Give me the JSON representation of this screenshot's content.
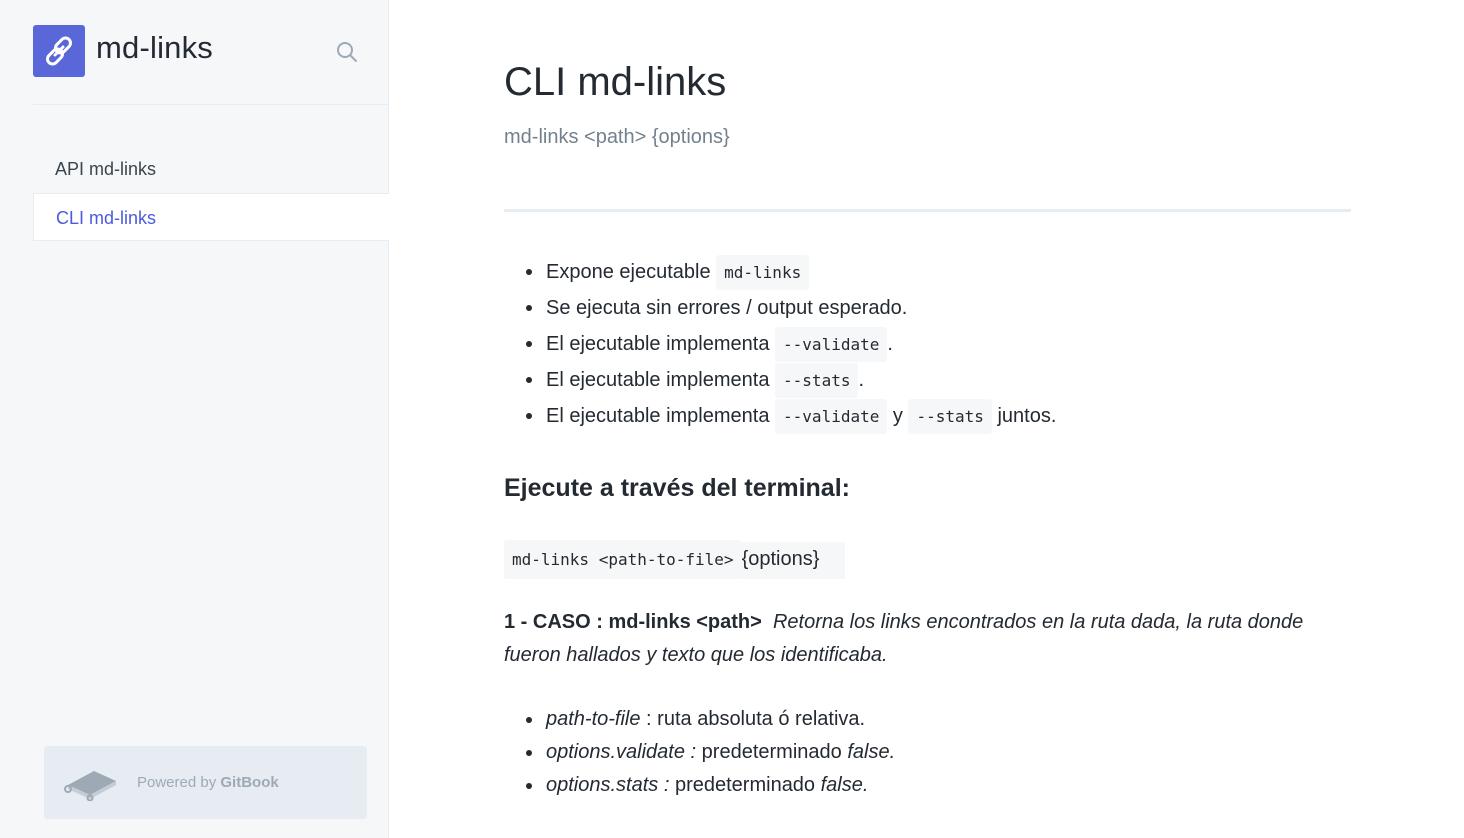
{
  "sidebar": {
    "brand": "md-links",
    "nav": [
      {
        "label": "API md-links",
        "active": false
      },
      {
        "label": "CLI md-links",
        "active": true
      }
    ],
    "powered_prefix": "Powered by",
    "powered_brand": "GitBook"
  },
  "main": {
    "title": "CLI md-links",
    "subtitle": "md-links <path> {options}",
    "features": [
      {
        "text": "Expone ejecutable",
        "code": "md-links"
      },
      {
        "text": "Se ejecuta sin errores / output esperado."
      },
      {
        "text": "El ejecutable implementa",
        "code": "--validate",
        "suffix": "."
      },
      {
        "text": "El ejecutable implementa",
        "code": "--stats",
        "suffix": "."
      },
      {
        "text": "El ejecutable implementa",
        "code": "--validate",
        "mid": "y",
        "code2": "--stats",
        "suffix": "juntos."
      }
    ],
    "section_heading": "Ejecute a través del terminal:",
    "command": "md-links <path-to-file>",
    "command_options": "{options}",
    "case_label": "1 - CASO : md-links <path>",
    "case_text": "Retorna  los links encontrados en la ruta dada, la ruta donde fueron hallados y texto que los identificaba.",
    "params": [
      {
        "name": "path-to-file",
        "sep": " : ",
        "desc": "ruta absoluta ó relativa.",
        "value": ""
      },
      {
        "name": "options.validate :",
        "sep": " ",
        "desc": "predeterminado",
        "value": "false."
      },
      {
        "name": "options.stats :",
        "sep": " ",
        "desc": "predeterminado",
        "value": "false."
      }
    ]
  },
  "colors": {
    "accent": "#5a67d8",
    "active_link": "#4b5bdc",
    "sidebar_bg": "#f5f7f9"
  },
  "icons": {
    "logo": "link-icon",
    "search": "search-icon",
    "gitbook": "gitbook-icon"
  }
}
